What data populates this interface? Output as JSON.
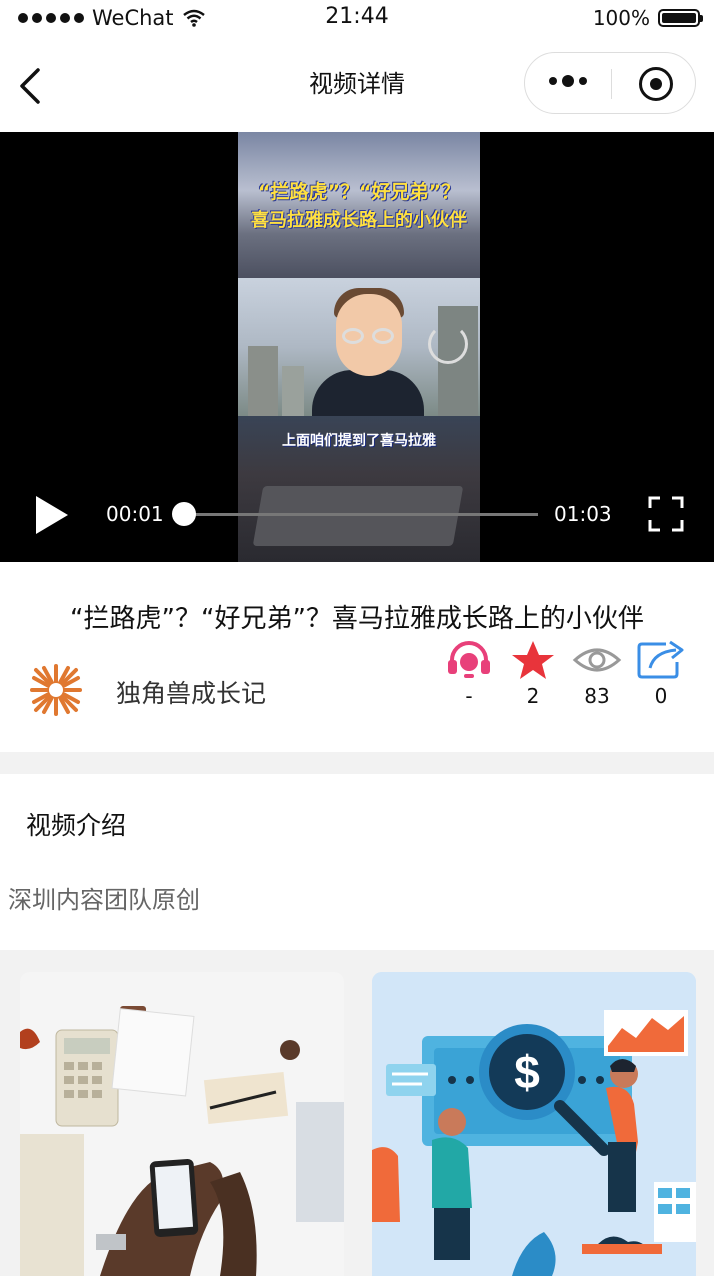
{
  "status_bar": {
    "carrier": "WeChat",
    "time": "21:44",
    "battery": "100%"
  },
  "nav": {
    "title": "视频详情"
  },
  "video": {
    "overlay_line1": "“拦路虎”？“好兄弟”？",
    "overlay_line2": "喜马拉雅成长路上的小伙伴",
    "subtitle": "上面咱们提到了喜马拉雅",
    "current_time": "00:01",
    "duration": "01:03",
    "progress": 0.0
  },
  "detail": {
    "title": "“拦路虎”？“好兄弟”？喜马拉雅成长路上的小伙伴",
    "author": "独角兽成长记",
    "stats": [
      {
        "icon": "headset-icon",
        "value": "-",
        "color": "#e8407a"
      },
      {
        "icon": "star-icon",
        "value": "2",
        "color": "#e8343b"
      },
      {
        "icon": "eye-icon",
        "value": "83",
        "color": "#999999"
      },
      {
        "icon": "share-icon",
        "value": "0",
        "color": "#3a8ee6"
      }
    ]
  },
  "intro": {
    "heading": "视频介绍",
    "text": "深圳内容团队原创"
  },
  "related": [
    {
      "image": "business-desk-photo"
    },
    {
      "image": "finance-dollar-illustration"
    }
  ]
}
